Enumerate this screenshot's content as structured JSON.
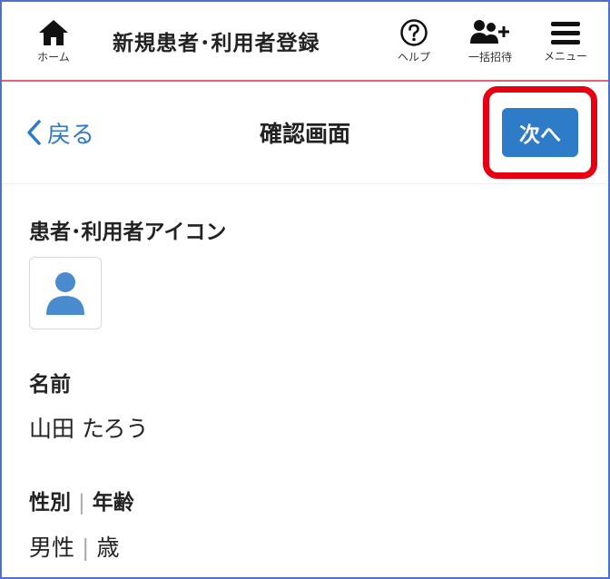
{
  "header": {
    "home_label": "ホーム",
    "title": "新規患者･利用者登録",
    "help_label": "ヘルプ",
    "invite_label": "一括招待",
    "menu_label": "メニュー"
  },
  "subbar": {
    "back_label": "戻る",
    "screen_title": "確認画面",
    "next_label": "次へ"
  },
  "content": {
    "icon_label": "患者･利用者アイコン",
    "name_label": "名前",
    "name_value": "山田 たろう",
    "gender_label": "性別",
    "age_label": "年齢",
    "gender_value": "男性",
    "age_value": "歳"
  },
  "colors": {
    "accent": "#2e7bc7",
    "header_border": "#e8616f",
    "highlight": "#e60012",
    "frame": "#4b74c8"
  }
}
